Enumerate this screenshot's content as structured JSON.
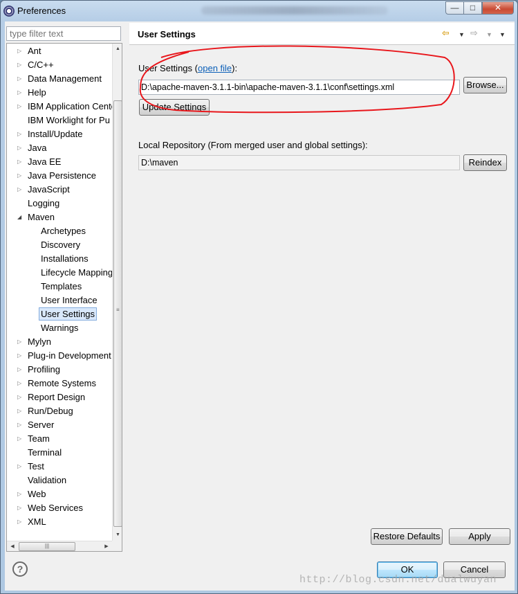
{
  "window": {
    "title": "Preferences"
  },
  "filter": {
    "placeholder": "type filter text"
  },
  "tree": {
    "items": [
      {
        "label": "Ant",
        "level": 0,
        "expander": "collapsed"
      },
      {
        "label": "C/C++",
        "level": 0,
        "expander": "collapsed"
      },
      {
        "label": "Data Management",
        "level": 0,
        "expander": "collapsed"
      },
      {
        "label": "Help",
        "level": 0,
        "expander": "collapsed"
      },
      {
        "label": "IBM Application Cente",
        "level": 0,
        "expander": "collapsed"
      },
      {
        "label": "IBM Worklight for Pu",
        "level": 0,
        "expander": "none"
      },
      {
        "label": "Install/Update",
        "level": 0,
        "expander": "collapsed"
      },
      {
        "label": "Java",
        "level": 0,
        "expander": "collapsed"
      },
      {
        "label": "Java EE",
        "level": 0,
        "expander": "collapsed"
      },
      {
        "label": "Java Persistence",
        "level": 0,
        "expander": "collapsed"
      },
      {
        "label": "JavaScript",
        "level": 0,
        "expander": "collapsed"
      },
      {
        "label": "Logging",
        "level": 0,
        "expander": "none"
      },
      {
        "label": "Maven",
        "level": 0,
        "expander": "expanded"
      },
      {
        "label": "Archetypes",
        "level": 1,
        "expander": "none"
      },
      {
        "label": "Discovery",
        "level": 1,
        "expander": "none"
      },
      {
        "label": "Installations",
        "level": 1,
        "expander": "none"
      },
      {
        "label": "Lifecycle Mapping",
        "level": 1,
        "expander": "none"
      },
      {
        "label": "Templates",
        "level": 1,
        "expander": "none"
      },
      {
        "label": "User Interface",
        "level": 1,
        "expander": "none"
      },
      {
        "label": "User Settings",
        "level": 1,
        "expander": "none",
        "selected": true
      },
      {
        "label": "Warnings",
        "level": 1,
        "expander": "none"
      },
      {
        "label": "Mylyn",
        "level": 0,
        "expander": "collapsed"
      },
      {
        "label": "Plug-in Development",
        "level": 0,
        "expander": "collapsed"
      },
      {
        "label": "Profiling",
        "level": 0,
        "expander": "collapsed"
      },
      {
        "label": "Remote Systems",
        "level": 0,
        "expander": "collapsed"
      },
      {
        "label": "Report Design",
        "level": 0,
        "expander": "collapsed"
      },
      {
        "label": "Run/Debug",
        "level": 0,
        "expander": "collapsed"
      },
      {
        "label": "Server",
        "level": 0,
        "expander": "collapsed"
      },
      {
        "label": "Team",
        "level": 0,
        "expander": "collapsed"
      },
      {
        "label": "Terminal",
        "level": 0,
        "expander": "none"
      },
      {
        "label": "Test",
        "level": 0,
        "expander": "collapsed"
      },
      {
        "label": "Validation",
        "level": 0,
        "expander": "none"
      },
      {
        "label": "Web",
        "level": 0,
        "expander": "collapsed"
      },
      {
        "label": "Web Services",
        "level": 0,
        "expander": "collapsed"
      },
      {
        "label": "XML",
        "level": 0,
        "expander": "collapsed"
      }
    ]
  },
  "page": {
    "title": "User Settings",
    "user_settings_label": "User Settings",
    "user_settings_open_paren": " (",
    "open_file_link": "open file",
    "user_settings_close_paren": "):",
    "user_settings_path": "D:\\apache-maven-3.1.1-bin\\apache-maven-3.1.1\\conf\\settings.xml",
    "browse_label": "Browse...",
    "update_label": "Update Settings",
    "local_repo_label": "Local Repository (From merged user and global settings):",
    "local_repo_path": "D:\\maven",
    "reindex_label": "Reindex",
    "restore_defaults_label": "Restore Defaults",
    "apply_label": "Apply",
    "annotation_color": "#e8161b"
  },
  "dialog": {
    "ok_label": "OK",
    "cancel_label": "Cancel",
    "help_symbol": "?"
  },
  "watermark": "http://blog.csdn.net/dualwuyan"
}
